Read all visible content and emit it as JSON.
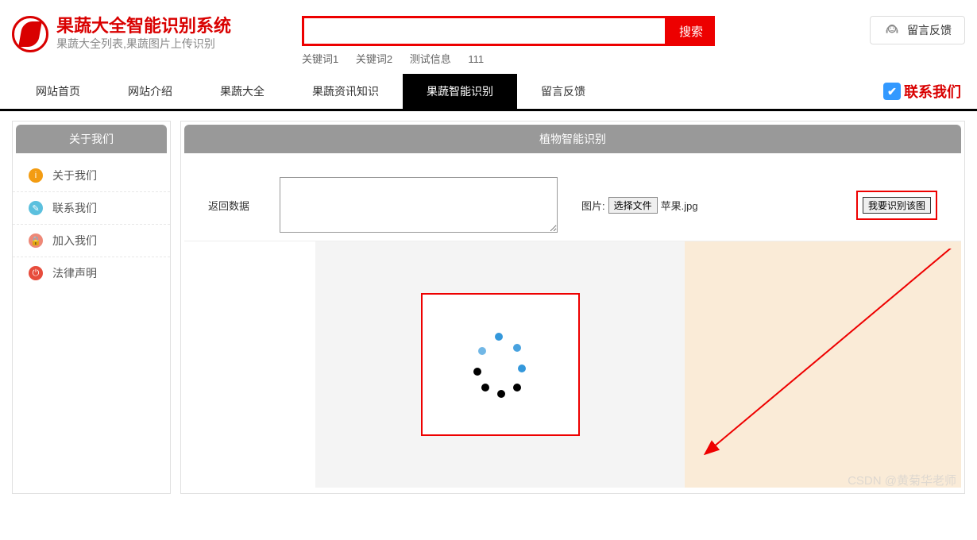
{
  "header": {
    "title": "果蔬大全智能识别系统",
    "subtitle": "果蔬大全列表,果蔬图片上传识别",
    "feedback_label": "留言反馈"
  },
  "search": {
    "button_label": "搜索",
    "keywords": [
      "关键词1",
      "关键词2",
      "测试信息",
      "111"
    ]
  },
  "nav": {
    "items": [
      "网站首页",
      "网站介绍",
      "果蔬大全",
      "果蔬资讯知识",
      "果蔬智能识别",
      "留言反馈"
    ],
    "active_index": 4,
    "contact_label": "联系我们"
  },
  "sidebar": {
    "header": "关于我们",
    "items": [
      {
        "label": "关于我们",
        "icon": "info-icon",
        "color": "ic-orange",
        "glyph": "i"
      },
      {
        "label": "联系我们",
        "icon": "contact-icon",
        "color": "ic-blue",
        "glyph": "✎"
      },
      {
        "label": "加入我们",
        "icon": "lock-icon",
        "color": "ic-pink",
        "glyph": "🔒"
      },
      {
        "label": "法律声明",
        "icon": "power-icon",
        "color": "ic-red",
        "glyph": "⏻"
      }
    ]
  },
  "content": {
    "header": "植物智能识别",
    "return_label": "返回数据",
    "image_label": "图片:",
    "choose_file_label": "选择文件",
    "file_name": "苹果.jpg",
    "recognize_label": "我要识别该图"
  },
  "watermark": "CSDN @黄菊华老师"
}
